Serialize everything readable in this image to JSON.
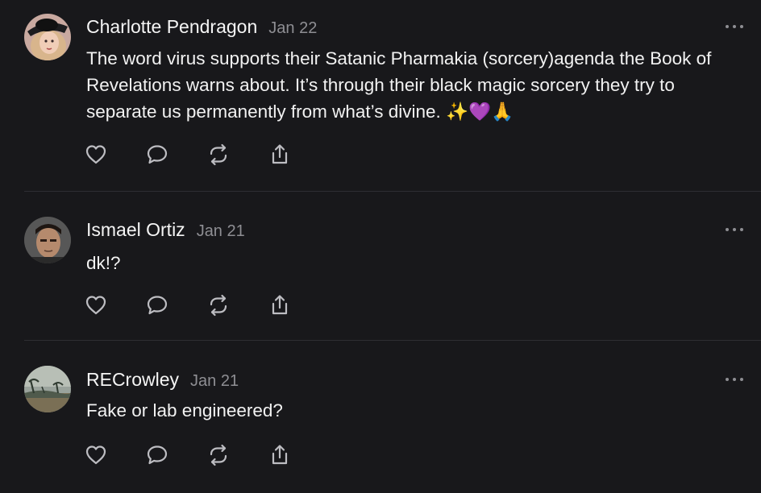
{
  "posts": [
    {
      "author": "Charlotte Pendragon",
      "date": "Jan 22",
      "text": "The word virus supports their Satanic Pharmakia (sorcery)agenda the Book of Revelations warns about. It’s through their black magic sorcery they try to separate us permanently from what’s divine. ✨💜🙏",
      "avatar_icon": "avatar-woman-hat"
    },
    {
      "author": "Ismael Ortiz",
      "date": "Jan 21",
      "text": "dk!?",
      "avatar_icon": "avatar-man"
    },
    {
      "author": "RECrowley",
      "date": "Jan 21",
      "text": "Fake or lab engineered?",
      "avatar_icon": "avatar-landscape"
    }
  ],
  "actions": {
    "icons": [
      "heart-icon",
      "comment-icon",
      "repost-icon",
      "share-icon"
    ],
    "color": "#bdbdc2"
  },
  "colors": {
    "background": "#18181b",
    "text": "#f2f2f2",
    "muted": "#8e8e93",
    "divider": "#2e2e33"
  }
}
